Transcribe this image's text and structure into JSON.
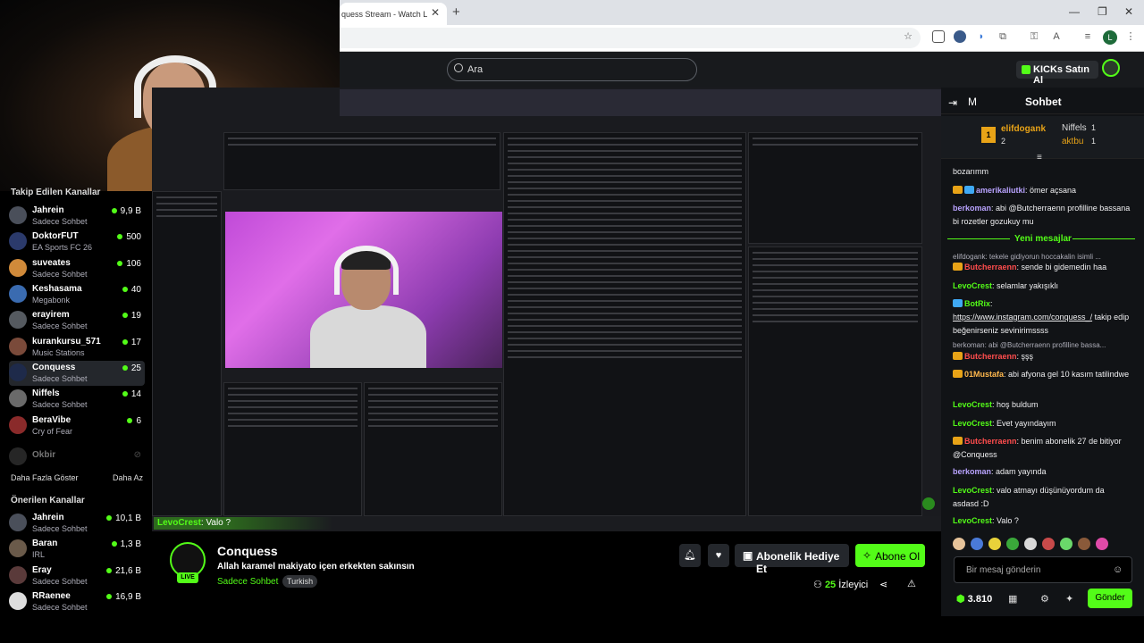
{
  "browser": {
    "tab_title": "quess Stream - Watch L",
    "tab_close": "✕",
    "new_tab": "+",
    "win_min": "—",
    "win_max": "❐",
    "win_close": "✕",
    "profile_initial": "L"
  },
  "site": {
    "search_placeholder": "Ara",
    "kicks_label": "KICKs Satın Al"
  },
  "sidebar": {
    "followed_header": "Takip Edilen Kanallar",
    "followed": [
      {
        "name": "Jahrein",
        "category": "Sadece Sohbet",
        "viewers": "9,9 B",
        "color": "#4a4f5a"
      },
      {
        "name": "DoktorFUT",
        "category": "EA Sports FC 26",
        "viewers": "500",
        "color": "#2b3a6b"
      },
      {
        "name": "suveates",
        "category": "Sadece Sohbet",
        "viewers": "106",
        "color": "#d08a3a"
      },
      {
        "name": "Keshasama",
        "category": "Megabonk",
        "viewers": "40",
        "color": "#3a6bb0"
      },
      {
        "name": "erayirem",
        "category": "Sadece Sohbet",
        "viewers": "19",
        "color": "#555a60"
      },
      {
        "name": "kurankursu_571",
        "category": "Music Stations",
        "viewers": "17",
        "color": "#7a4a3a"
      },
      {
        "name": "Conquess",
        "category": "Sadece Sohbet",
        "viewers": "25",
        "color": "#1e2a4a"
      },
      {
        "name": "Niffels",
        "category": "Sadece Sohbet",
        "viewers": "14",
        "color": "#6a6a6a"
      },
      {
        "name": "BeraVibe",
        "category": "Cry of Fear",
        "viewers": "6",
        "color": "#8a2a2a"
      }
    ],
    "offline_name": "Okbir",
    "show_more": "Daha Fazla Göster",
    "show_less": "Daha Az",
    "recommended_header": "Önerilen Kanallar",
    "recommended": [
      {
        "name": "Jahrein",
        "category": "Sadece Sohbet",
        "viewers": "10,1 B",
        "color": "#4a4f5a"
      },
      {
        "name": "Baran",
        "category": "IRL",
        "viewers": "1,3 B",
        "color": "#6a5a4a"
      },
      {
        "name": "Eray",
        "category": "Sadece Sohbet",
        "viewers": "21,6 B",
        "color": "#5a3a3a"
      },
      {
        "name": "RRaenee",
        "category": "Sadece Sohbet",
        "viewers": "16,9 B",
        "color": "#ddd"
      }
    ]
  },
  "video": {
    "overlay_user": "LevoCrest",
    "overlay_text": ": Valo ?"
  },
  "stream": {
    "name": "Conquess",
    "title": "Allah karamel makiyato içen erkekten sakınsın",
    "category": "Sadece Sohbet",
    "tag": "Turkish",
    "live_label": "LIVE",
    "gift_label": "Abonelik Hediye Et",
    "subscribe_label": "Abone Ol",
    "viewer_count": "25",
    "viewer_label": "İzleyici"
  },
  "chat": {
    "menu_letter": "M",
    "title": "Sohbet",
    "leaders": [
      {
        "rank": "1",
        "name": "elifdogank",
        "count": "2"
      },
      {
        "name": "Niffels",
        "count": "1"
      },
      {
        "name": "aktbu",
        "count": "1"
      }
    ],
    "new_messages_label": "Yeni mesajlar",
    "input_placeholder": "Bir mesaj gönderin",
    "send_label": "Gönder",
    "points": "3.810",
    "messages": {
      "m0": "bozarımm",
      "m1_user": "amerikaliutki",
      "m1_text": ": ömer açsana",
      "m2_user": "berkoman",
      "m2_text": ": abi @Butcherraenn profilline bassana bi rozetler gozukuy mu",
      "m3_reply": "elifdogank: tekele gidiyorun hoccakalin isimli ...",
      "m3_user": "Butcherraenn",
      "m3_text": ": sende bi gidemedin haa",
      "m4_user": "LevoCrest",
      "m4_text": ": selamlar yakışıklı",
      "m5_user": "BotRix",
      "m5_text": ":",
      "m5_link": "https://www.instagram.com/conquess_/",
      "m5_rest": "takip edip beğenirseniz sevinirimssss",
      "m6_reply": "berkoman: abi @Butcherraenn profilline bassa...",
      "m6_user": "Butcherraenn",
      "m6_text": ": şşş",
      "m7_user": "01Mustafa",
      "m7_text": ": abi afyona gel 10 kasım tatilindwe",
      "m8_user": "LevoCrest",
      "m8_text": ": hoş buldum",
      "m9_user": "LevoCrest",
      "m9_text": ": Evet yayındayım",
      "m10_user": "Butcherraenn",
      "m10_text": ": benim abonelik 27 de bitiyor @Conquess",
      "m11_user": "berkoman",
      "m11_text": ": adam yayında",
      "m12_user": "LevoCrest",
      "m12_text": ": valo atmayı düşünüyordum da asdasd :D",
      "m13_user": "LevoCrest",
      "m13_text": ": Valo ?"
    }
  }
}
